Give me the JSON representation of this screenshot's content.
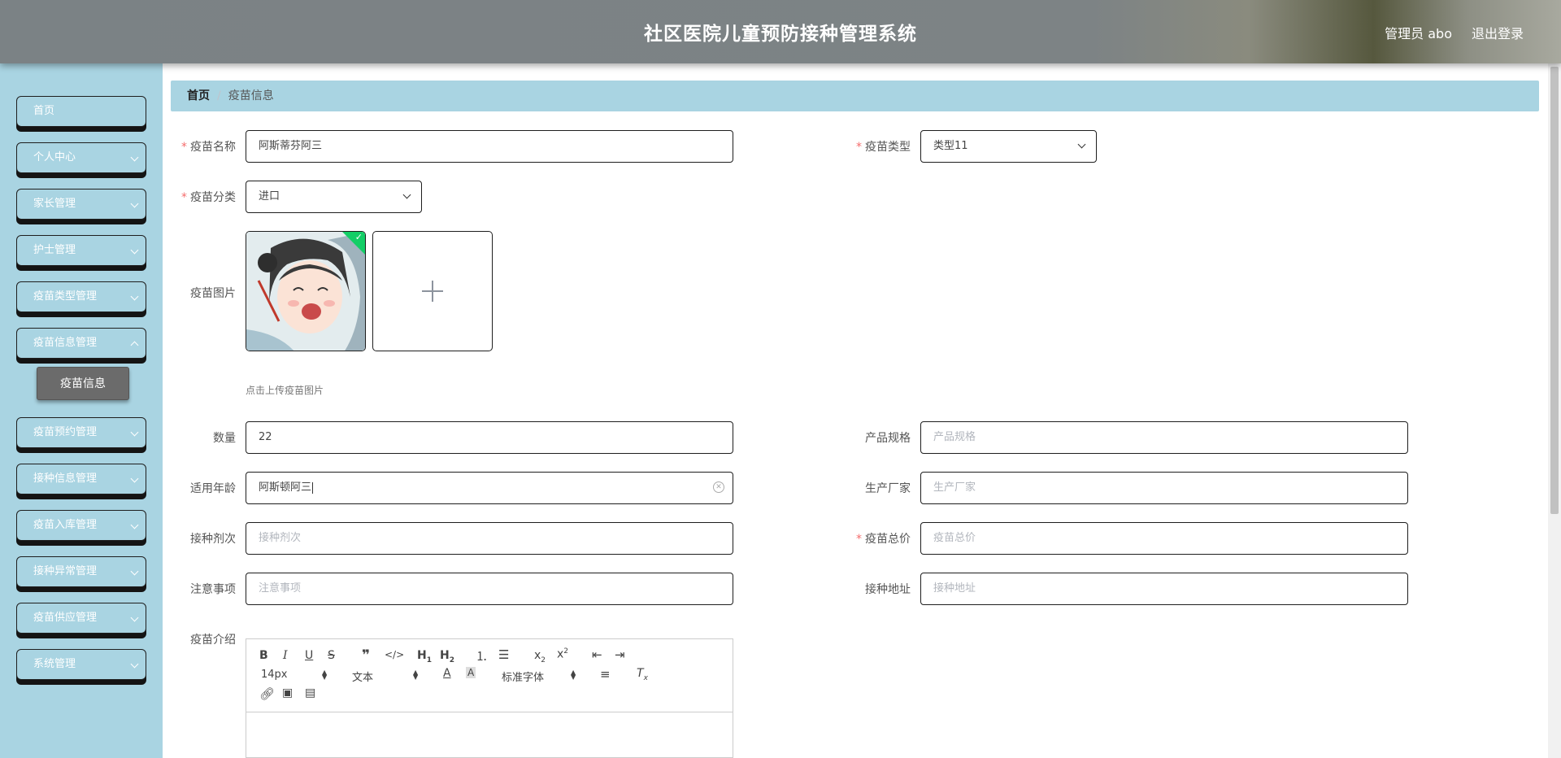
{
  "header": {
    "title": "社区医院儿童预防接种管理系统",
    "user": "管理员 abo",
    "logout": "退出登录"
  },
  "sidebar": {
    "items": [
      {
        "label": "首页",
        "has_arrow": false
      },
      {
        "label": "个人中心",
        "has_arrow": true
      },
      {
        "label": "家长管理",
        "has_arrow": true
      },
      {
        "label": "护士管理",
        "has_arrow": true
      },
      {
        "label": "疫苗类型管理",
        "has_arrow": true
      },
      {
        "label": "疫苗信息管理",
        "has_arrow": true
      },
      {
        "label": "疫苗预约管理",
        "has_arrow": true
      },
      {
        "label": "接种信息管理",
        "has_arrow": true
      },
      {
        "label": "疫苗入库管理",
        "has_arrow": true
      },
      {
        "label": "接种异常管理",
        "has_arrow": true
      },
      {
        "label": "疫苗供应管理",
        "has_arrow": true
      },
      {
        "label": "系统管理",
        "has_arrow": true
      }
    ],
    "active_sub": "疫苗信息"
  },
  "breadcrumb": {
    "home": "首页",
    "separator": "/",
    "current": "疫苗信息"
  },
  "form": {
    "vaccine_name": {
      "label": "疫苗名称",
      "required": true,
      "value": "阿斯蒂芬阿三"
    },
    "vaccine_type": {
      "label": "疫苗类型",
      "required": true,
      "value": "类型11"
    },
    "vaccine_category": {
      "label": "疫苗分类",
      "required": true,
      "value": "进口"
    },
    "vaccine_image": {
      "label": "疫苗图片",
      "tip": "点击上传疫苗图片"
    },
    "quantity": {
      "label": "数量",
      "value": "22"
    },
    "spec": {
      "label": "产品规格",
      "placeholder": "产品规格"
    },
    "age": {
      "label": "适用年龄",
      "value": "阿斯顿阿三"
    },
    "manufacturer": {
      "label": "生产厂家",
      "placeholder": "生产厂家"
    },
    "doses": {
      "label": "接种剂次",
      "placeholder": "接种剂次"
    },
    "total_price": {
      "label": "疫苗总价",
      "required": true,
      "placeholder": "疫苗总价"
    },
    "notes": {
      "label": "注意事项",
      "placeholder": "注意事项"
    },
    "address": {
      "label": "接种地址",
      "placeholder": "接种地址"
    },
    "intro": {
      "label": "疫苗介绍"
    }
  },
  "editor": {
    "font_size": "14px",
    "header": "文本",
    "font": "标准字体"
  },
  "colors": {
    "sidebar_bg": "#a9d4e2",
    "required_mark": "#f56c6c",
    "upload_success": "#13ce66"
  }
}
